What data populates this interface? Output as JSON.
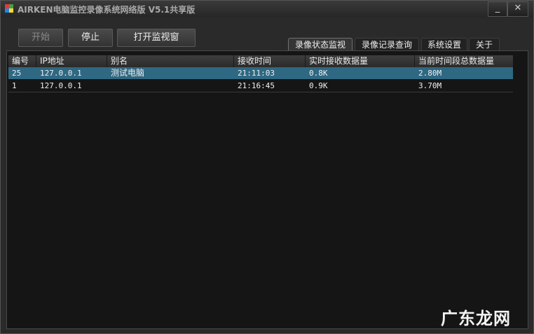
{
  "window": {
    "title": "AIRKEN电脑监控录像系统网络版 V5.1共享版",
    "minimize_glyph": "_",
    "close_glyph": "✕"
  },
  "toolbar": {
    "start_label": "开始",
    "stop_label": "停止",
    "open_monitor_label": "打开监视窗"
  },
  "tabs": [
    {
      "label": "录像状态监视",
      "active": true
    },
    {
      "label": "录像记录查询",
      "active": false
    },
    {
      "label": "系统设置",
      "active": false
    },
    {
      "label": "关于",
      "active": false
    }
  ],
  "table": {
    "columns": [
      "编号",
      "IP地址",
      "别名",
      "接收时间",
      "实时接收数据量",
      "当前时间段总数据量"
    ],
    "rows": [
      {
        "id": "25",
        "ip": "127.0.0.1",
        "alias": "测试电脑",
        "time": "21:11:03",
        "realtime": "0.8K",
        "total": "2.80M",
        "selected": true
      },
      {
        "id": "1",
        "ip": "127.0.0.1",
        "alias": "",
        "time": "21:16:45",
        "realtime": "0.9K",
        "total": "3.70M",
        "selected": false
      }
    ]
  },
  "watermark": "广东龙网",
  "colors": {
    "selected_row": "#2f6882",
    "background": "#151515",
    "app_icon": [
      "#e53935",
      "#43a047",
      "#1e88e5",
      "#fdd835"
    ]
  }
}
